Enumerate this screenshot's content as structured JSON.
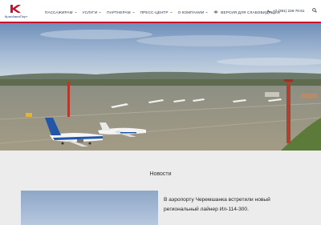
{
  "header": {
    "logo_text": "КрасАвиаПорт",
    "logo_color": "#c8102e",
    "nav": [
      {
        "label": "ПАССАЖИРАМ",
        "has_dropdown": true
      },
      {
        "label": "УСЛУГИ",
        "has_dropdown": true
      },
      {
        "label": "ПАРТНЕРАМ",
        "has_dropdown": true
      },
      {
        "label": "ПРЕСС-ЦЕНТР",
        "has_dropdown": true
      },
      {
        "label": "О КОМПАНИИ",
        "has_dropdown": true
      }
    ],
    "accessibility_label": "ВЕРСИЯ ДЛЯ СЛАБОВИДЯЩИХ",
    "phone": "+7 (391) 226-76-61",
    "icons": [
      "eye-icon",
      "phone-icon",
      "search-icon"
    ]
  },
  "hero": {
    "description_icon": "airport-apron-photo"
  },
  "news": {
    "title": "Новости",
    "item_text": "В аэропорту Черемшанка встретили новый региональный лайнер Ил-114-300."
  }
}
